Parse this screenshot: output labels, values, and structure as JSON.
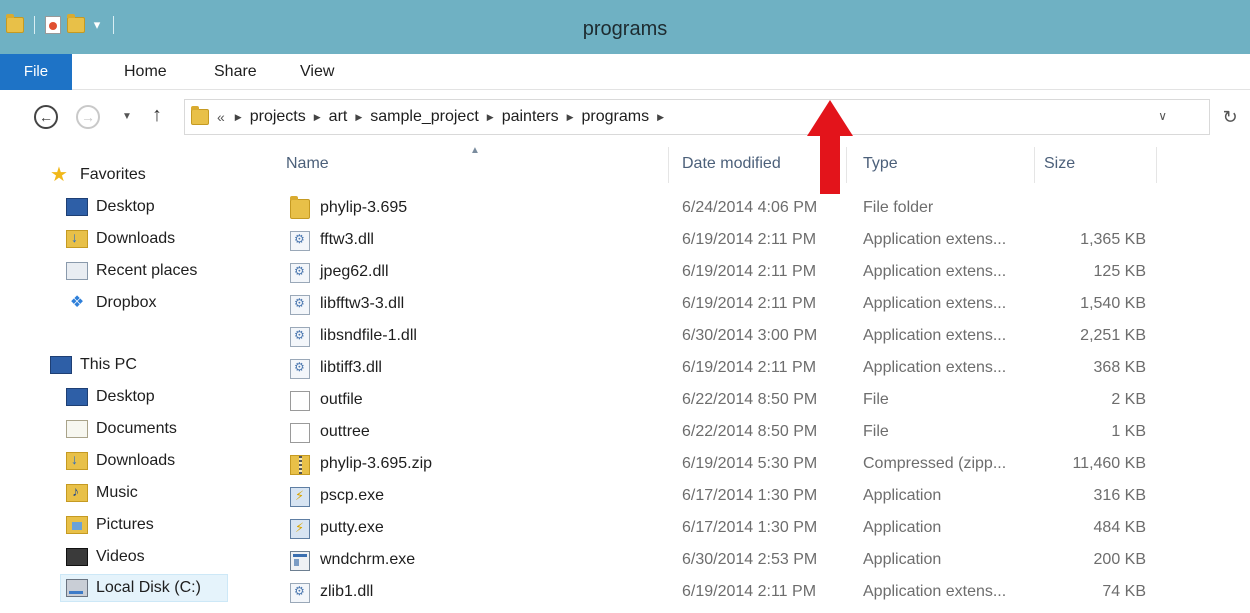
{
  "window": {
    "title": "programs"
  },
  "ribbon": {
    "tabs": [
      "File",
      "Home",
      "Share",
      "View"
    ]
  },
  "address": {
    "overflow": "«",
    "crumbs": [
      "projects",
      "art",
      "sample_project",
      "painters",
      "programs"
    ]
  },
  "nav": {
    "favorites": {
      "label": "Favorites",
      "items": [
        {
          "label": "Desktop",
          "icon": "desktop-icon"
        },
        {
          "label": "Downloads",
          "icon": "downloads-icon"
        },
        {
          "label": "Recent places",
          "icon": "recent-places-icon"
        },
        {
          "label": "Dropbox",
          "icon": "dropbox-icon"
        }
      ]
    },
    "thispc": {
      "label": "This PC",
      "items": [
        {
          "label": "Desktop",
          "icon": "desktop-icon"
        },
        {
          "label": "Documents",
          "icon": "documents-icon"
        },
        {
          "label": "Downloads",
          "icon": "downloads-icon"
        },
        {
          "label": "Music",
          "icon": "music-icon"
        },
        {
          "label": "Pictures",
          "icon": "pictures-icon"
        },
        {
          "label": "Videos",
          "icon": "videos-icon"
        },
        {
          "label": "Local Disk (C:)",
          "icon": "local-disk-icon"
        }
      ]
    }
  },
  "columns": {
    "name": "Name",
    "date": "Date modified",
    "type": "Type",
    "size": "Size"
  },
  "files": [
    {
      "name": "phylip-3.695",
      "date": "6/24/2014 4:06 PM",
      "type": "File folder",
      "size": "",
      "icon": "folder"
    },
    {
      "name": "fftw3.dll",
      "date": "6/19/2014 2:11 PM",
      "type": "Application extens...",
      "size": "1,365 KB",
      "icon": "dll"
    },
    {
      "name": "jpeg62.dll",
      "date": "6/19/2014 2:11 PM",
      "type": "Application extens...",
      "size": "125 KB",
      "icon": "dll"
    },
    {
      "name": "libfftw3-3.dll",
      "date": "6/19/2014 2:11 PM",
      "type": "Application extens...",
      "size": "1,540 KB",
      "icon": "dll"
    },
    {
      "name": "libsndfile-1.dll",
      "date": "6/30/2014 3:00 PM",
      "type": "Application extens...",
      "size": "2,251 KB",
      "icon": "dll"
    },
    {
      "name": "libtiff3.dll",
      "date": "6/19/2014 2:11 PM",
      "type": "Application extens...",
      "size": "368 KB",
      "icon": "dll"
    },
    {
      "name": "outfile",
      "date": "6/22/2014 8:50 PM",
      "type": "File",
      "size": "2 KB",
      "icon": "blank"
    },
    {
      "name": "outtree",
      "date": "6/22/2014 8:50 PM",
      "type": "File",
      "size": "1 KB",
      "icon": "blank"
    },
    {
      "name": "phylip-3.695.zip",
      "date": "6/19/2014 5:30 PM",
      "type": "Compressed (zipp...",
      "size": "11,460 KB",
      "icon": "zip"
    },
    {
      "name": "pscp.exe",
      "date": "6/17/2014 1:30 PM",
      "type": "Application",
      "size": "316 KB",
      "icon": "putty"
    },
    {
      "name": "putty.exe",
      "date": "6/17/2014 1:30 PM",
      "type": "Application",
      "size": "484 KB",
      "icon": "putty"
    },
    {
      "name": "wndchrm.exe",
      "date": "6/30/2014 2:53 PM",
      "type": "Application",
      "size": "200 KB",
      "icon": "exe"
    },
    {
      "name": "zlib1.dll",
      "date": "6/19/2014 2:11 PM",
      "type": "Application extens...",
      "size": "74 KB",
      "icon": "dll"
    }
  ],
  "colors": {
    "titlebar": "#6fb1c3",
    "file_tab": "#1e73c6",
    "annotation_arrow": "#e3141b"
  }
}
